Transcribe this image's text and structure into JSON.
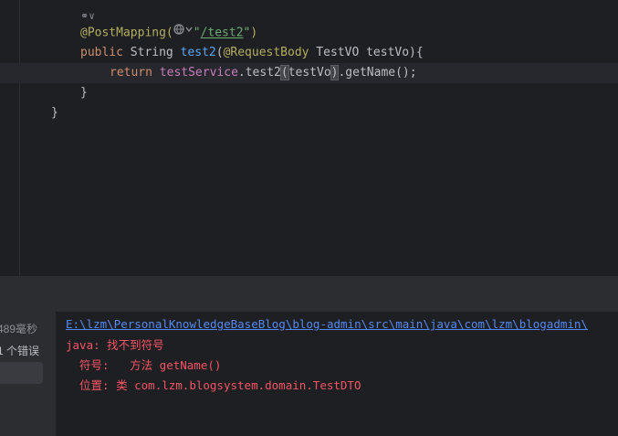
{
  "editor": {
    "usage_marker": "⚭∨",
    "line1": {
      "annotation": "@PostMapping(",
      "quote_open": "\"",
      "path": "/test2",
      "quote_close": "\"",
      "close": ")"
    },
    "line2": {
      "kw_public": "public",
      "type_string": " String ",
      "method_name": "test2",
      "open_paren": "(",
      "param_annotation": "@RequestBody",
      "param_rest": " TestVO testVo){"
    },
    "line3": {
      "kw_return": "return",
      "field": "testService",
      "call_a": ".test2",
      "paren_open": "(",
      "arg": "testVo",
      "paren_close": ")",
      "call_b": ".getName();"
    },
    "line4": "}",
    "line5": "}"
  },
  "build": {
    "tree_time": "489毫秒",
    "tree_errors": "1 个错误",
    "path": "E:\\lzm\\PersonalKnowledgeBaseBlog\\blog-admin\\src\\main\\java\\com\\lzm\\blogadmin\\",
    "error_title": "java: 找不到符号",
    "symbol_line": "  符号:   方法 getName()",
    "location_line": "  位置: 类 com.lzm.blogsystem.domain.TestDTO"
  },
  "colors": {
    "editor_bg": "#1e1f22",
    "keyword": "#cf8e6d",
    "annotation": "#b3ae60",
    "string": "#6aab73",
    "method": "#56a8f5",
    "field": "#c77dbb",
    "error_text": "#f75464",
    "link": "#548af7"
  }
}
